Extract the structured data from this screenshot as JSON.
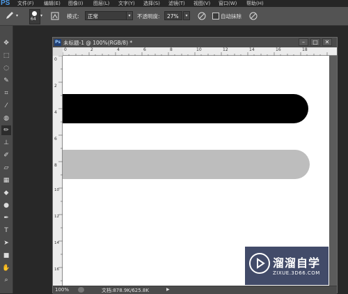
{
  "app": {
    "logo": "PS",
    "menus": [
      "文件(F)",
      "编辑(E)",
      "图像(I)",
      "图层(L)",
      "文字(Y)",
      "选择(S)",
      "滤镜(T)",
      "视图(V)",
      "窗口(W)",
      "帮助(H)"
    ]
  },
  "options": {
    "brush_size": "64",
    "mode_label": "模式:",
    "mode_value": "正常",
    "opacity_label": "不透明度:",
    "opacity_value": "27%",
    "auto_erase_label": "自动抹除",
    "icons": [
      "pencil-icon",
      "brush-preset-icon",
      "brush-panel-icon",
      "pressure-opacity-icon",
      "pressure-size-icon"
    ]
  },
  "tools": [
    "move-icon",
    "marquee-icon",
    "lasso-icon",
    "quick-select-icon",
    "crop-icon",
    "eyedropper-icon",
    "healing-icon",
    "pencil-icon",
    "stamp-icon",
    "history-brush-icon",
    "eraser-icon",
    "gradient-icon",
    "blur-icon",
    "dodge-icon",
    "pen-icon",
    "type-icon",
    "path-select-icon",
    "rectangle-icon",
    "hand-icon",
    "zoom-icon"
  ],
  "document": {
    "title": "未标题-1 @ 100%(RGB/8) *",
    "ruler_h": [
      "0",
      "2",
      "4",
      "6",
      "8",
      "10",
      "12",
      "14",
      "16",
      "18"
    ],
    "ruler_v": [
      "0",
      "2",
      "4",
      "6",
      "8",
      "10",
      "12",
      "14",
      "16"
    ],
    "shapes": [
      {
        "name": "black-stroke",
        "color": "#000000"
      },
      {
        "name": "gray-stroke",
        "color": "#bdbdbd"
      }
    ],
    "status": {
      "zoom": "100%",
      "doc_info": "文档:878.9K/625.8K"
    }
  },
  "watermark": {
    "title": "溜溜自学",
    "subtitle": "ZIXUE.3D66.COM"
  },
  "colors": {
    "accent": "#4e9be8",
    "watermark_bg": "#232d50"
  }
}
